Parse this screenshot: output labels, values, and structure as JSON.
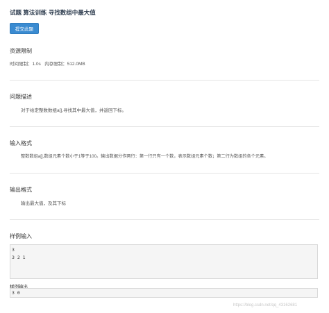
{
  "header": {
    "title": "试题 算法训练 寻找数组中最大值",
    "submit_label": "提交此题"
  },
  "resources": {
    "heading": "资源限制",
    "limits": "时间限制：1.0s   内存限制：512.0MB"
  },
  "problem": {
    "heading": "问题描述",
    "text": "对于给定整数数组a[],寻找其中最大值，并返回下标。"
  },
  "input_format": {
    "heading": "输入格式",
    "text": "整数数组a[],数组元素个数小于1等于100。输出数据分作两行：第一行只有一个数，表示数组元素个数；第二行为数组的各个元素。"
  },
  "output_format": {
    "heading": "输出格式",
    "text": "输出最大值，及其下标"
  },
  "sample_input": {
    "heading": "样例输入",
    "code": "3\n3 2 1"
  },
  "sample_output": {
    "heading": "样例输出",
    "code": "3 0"
  },
  "watermark": "https://blog.csdn.net/qq_43162681"
}
